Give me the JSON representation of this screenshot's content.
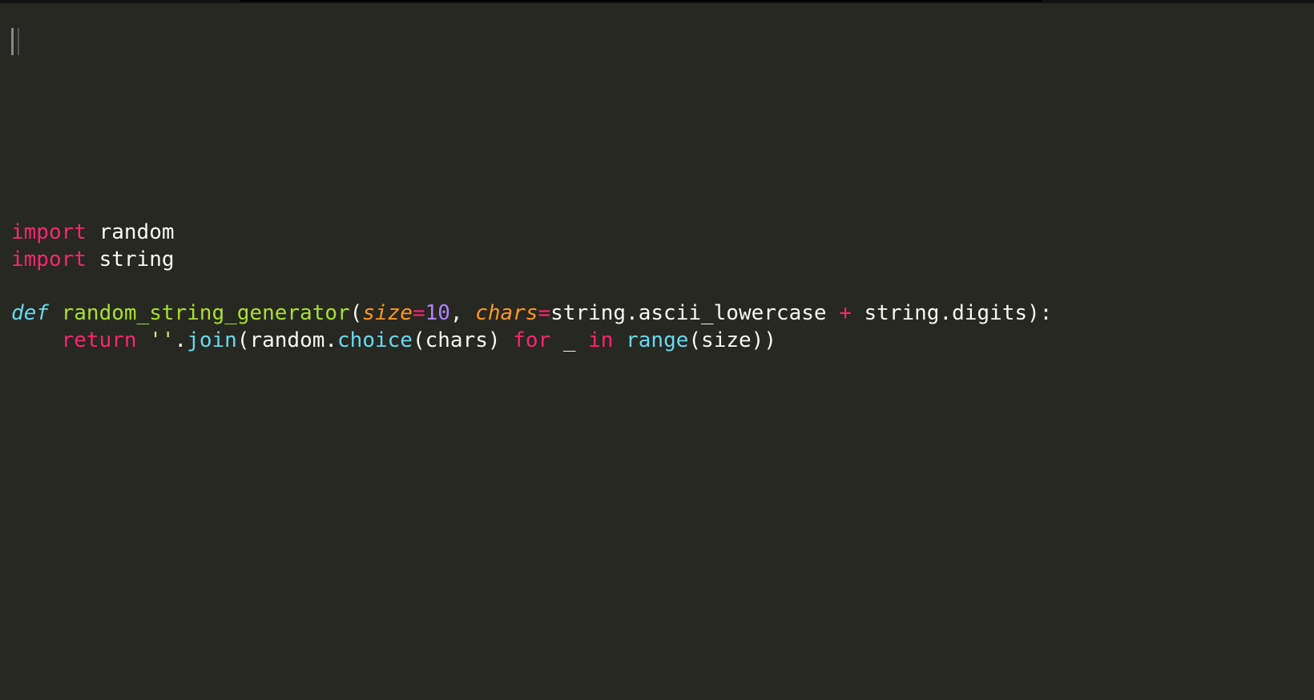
{
  "editor": {
    "theme": "monokai",
    "language": "python",
    "tokens": {
      "import": "import",
      "mod_random": "random",
      "mod_string": "string",
      "def": "def",
      "fn_name": "random_string_generator",
      "lparen": "(",
      "p_size": "size",
      "eq1": "=",
      "v_ten": "10",
      "comma1": ", ",
      "p_chars": "chars",
      "eq2": "=",
      "s_string1": "string",
      "dot1": ".",
      "attr_lowercase": "ascii_lowercase",
      "plus": " + ",
      "s_string2": "string",
      "dot2": ".",
      "attr_digits": "digits",
      "rparen_colon": "):",
      "return": "return",
      "space1": " ",
      "emptystr": "''",
      "dot3": ".",
      "join": "join",
      "lparen2": "(",
      "random2": "random",
      "dot4": ".",
      "choice": "choice",
      "lparen3": "(",
      "arg_chars": "chars",
      "rparen3": ")",
      "space2": " ",
      "for": "for",
      "space3": " ",
      "underscore": "_",
      "space4": " ",
      "in": "in",
      "space5": " ",
      "range": "range",
      "lparen4": "(",
      "arg_size": "size",
      "rparen4_x2": "))",
      "indent4": "    "
    }
  }
}
